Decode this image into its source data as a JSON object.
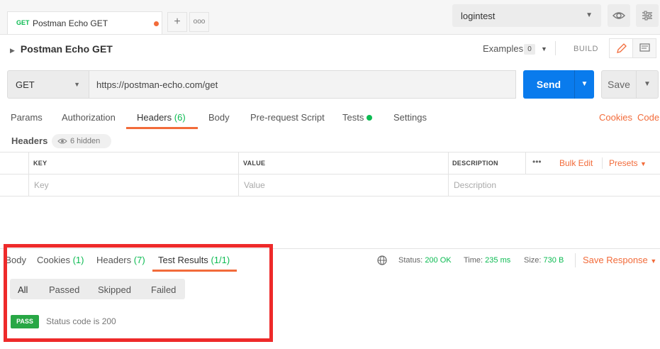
{
  "top": {
    "tab": {
      "method": "GET",
      "title": "Postman Echo GET"
    },
    "add_icon": "+",
    "more_icon": "ooo",
    "environment": {
      "name": "logintest",
      "caret": "▼"
    }
  },
  "request": {
    "name": "Postman Echo GET",
    "examples_label": "Examples",
    "examples_count": "0",
    "build_label": "BUILD",
    "method": "GET",
    "url": "https://postman-echo.com/get",
    "send_label": "Send",
    "save_label": "Save"
  },
  "req_tabs": {
    "params": "Params",
    "authorization": "Authorization",
    "headers": "Headers",
    "headers_count": "(6)",
    "body": "Body",
    "prerequest": "Pre-request Script",
    "tests": "Tests",
    "settings": "Settings",
    "cookies": "Cookies",
    "code": "Code"
  },
  "headers_section": {
    "label": "Headers",
    "hidden_label": "6 hidden",
    "columns": {
      "key": "KEY",
      "value": "VALUE",
      "description": "DESCRIPTION"
    },
    "placeholders": {
      "key": "Key",
      "value": "Value",
      "description": "Description"
    },
    "more": "•••",
    "bulk_edit": "Bulk Edit",
    "presets": "Presets"
  },
  "response": {
    "tabs": {
      "body": "Body",
      "cookies": "Cookies",
      "cookies_count": "(1)",
      "headers": "Headers",
      "headers_count": "(7)",
      "test_results": "Test Results",
      "test_results_count": "(1/1)"
    },
    "status_label": "Status:",
    "status_value": "200 OK",
    "time_label": "Time:",
    "time_value": "235 ms",
    "size_label": "Size:",
    "size_value": "730 B",
    "save_response": "Save Response",
    "filters": [
      "All",
      "Passed",
      "Skipped",
      "Failed"
    ],
    "result_badge": "PASS",
    "result_text": "Status code is 200"
  },
  "colors": {
    "accent": "#f26b3a",
    "send": "#097bed",
    "pass": "#28a745",
    "ok": "#0cbb52",
    "highlight": "#ee2a2a"
  }
}
